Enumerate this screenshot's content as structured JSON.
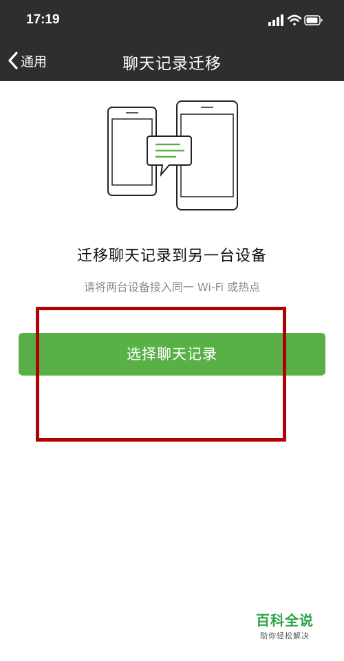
{
  "status_bar": {
    "time": "17:19",
    "icons": [
      "signal-icon",
      "wifi-icon",
      "battery-icon"
    ]
  },
  "nav": {
    "back_label": "通用",
    "title": "聊天记录迁移"
  },
  "content": {
    "illustration": "phone-transfer-icon",
    "heading": "迁移聊天记录到另一台设备",
    "subheading": "请将两台设备接入同一 Wi-Fi 或热点",
    "button_label": "选择聊天记录"
  },
  "watermark": {
    "title": "百科全说",
    "subtitle": "助你轻松解决"
  },
  "colors": {
    "bar_background": "#2e2e2e",
    "button_green": "#59b047",
    "highlight_red": "#b00000",
    "watermark_green": "#2da345"
  }
}
